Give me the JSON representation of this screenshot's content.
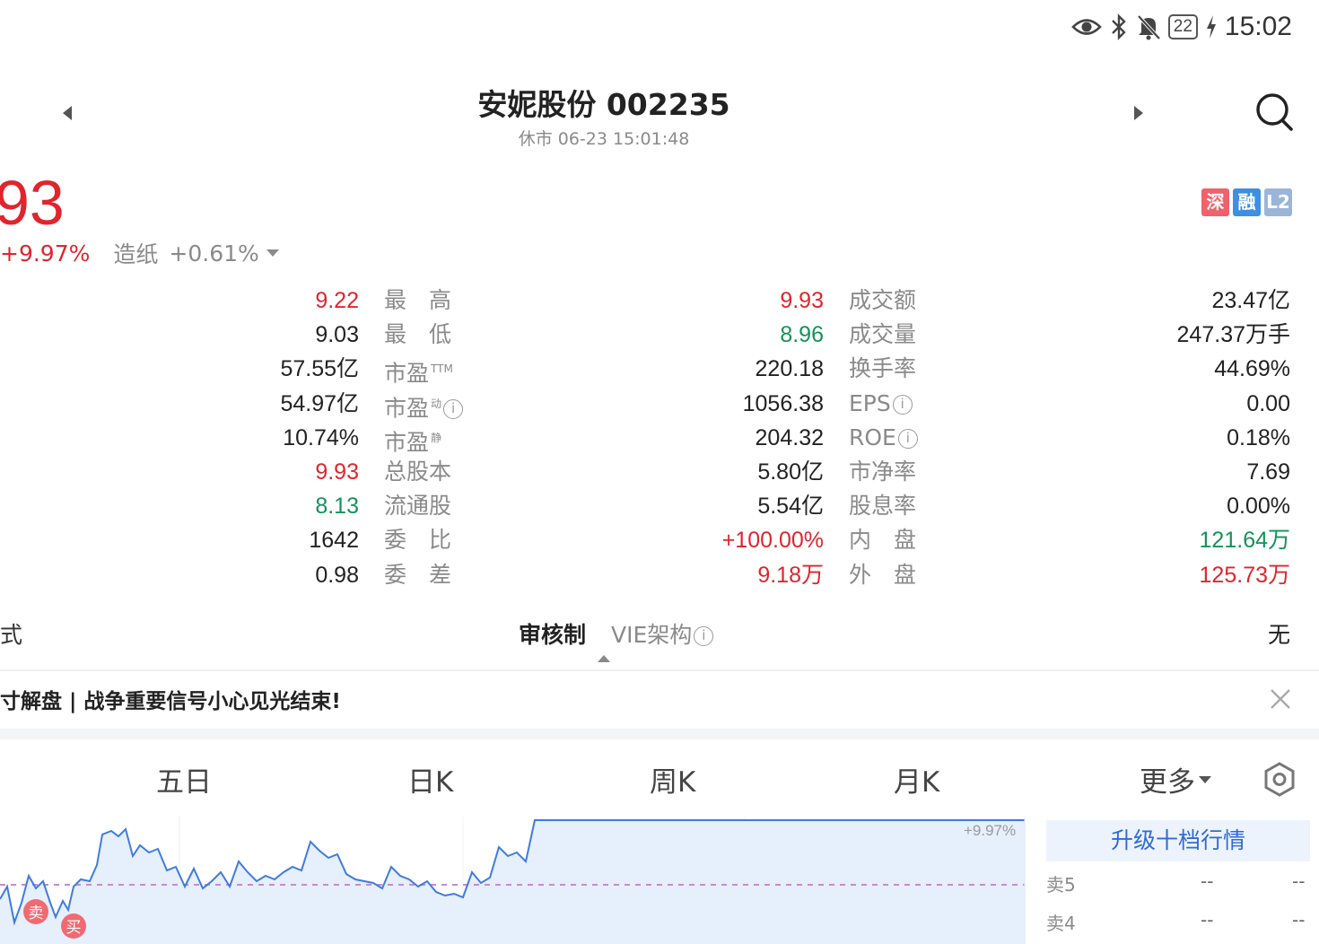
{
  "status_bar": {
    "battery": "22",
    "time": "15:02"
  },
  "header": {
    "title": "安妮股份 002235",
    "subtitle": "休市  06-23 15:01:48"
  },
  "price": {
    "last": "93",
    "change_pct": "+9.97%",
    "sector_name": "造纸",
    "sector_pct": "+0.61%"
  },
  "badges": [
    {
      "label": "深",
      "color": "#f0616b"
    },
    {
      "label": "融",
      "color": "#3d8fe3"
    },
    {
      "label": "L2",
      "color": "#9bb5d9"
    }
  ],
  "stats": [
    {
      "v1": "9.22",
      "c1": "red",
      "l1": "最　高",
      "v2": "9.93",
      "c2": "red",
      "l2": "成交额",
      "v3": "23.47亿",
      "c3": ""
    },
    {
      "v1": "9.03",
      "c1": "",
      "l1": "最　低",
      "v2": "8.96",
      "c2": "green",
      "l2": "成交量",
      "v3": "247.37万手",
      "c3": ""
    },
    {
      "v1": "57.55亿",
      "c1": "",
      "l1": "市盈",
      "s1": "TTM",
      "v2": "220.18",
      "c2": "",
      "l2": "换手率",
      "v3": "44.69%",
      "c3": ""
    },
    {
      "v1": "54.97亿",
      "c1": "",
      "l1": "市盈",
      "s1": "动",
      "v2": "1056.38",
      "c2": "",
      "l2": "EPS",
      "v3": "0.00",
      "c3": ""
    },
    {
      "v1": "10.74%",
      "c1": "",
      "l1": "市盈",
      "s1": "静",
      "v2": "204.32",
      "c2": "",
      "l2": "ROE",
      "v3": "0.18%",
      "c3": ""
    },
    {
      "v1": "9.93",
      "c1": "red",
      "l1": "总股本",
      "v2": "5.80亿",
      "c2": "",
      "l2": "市净率",
      "v3": "7.69",
      "c3": ""
    },
    {
      "v1": "8.13",
      "c1": "green",
      "l1": "流通股",
      "v2": "5.54亿",
      "c2": "",
      "l2": "股息率",
      "v3": "0.00%",
      "c3": ""
    },
    {
      "v1": "1642",
      "c1": "",
      "l1": "委　比",
      "v2": "+100.00%",
      "c2": "red",
      "l2": "内　盘",
      "v3": "121.64万",
      "c3": "green"
    },
    {
      "v1": "0.98",
      "c1": "",
      "l1": "委　差",
      "v2": "9.18万",
      "c2": "red",
      "l2": "外　盘",
      "v3": "125.73万",
      "c3": "red"
    }
  ],
  "audit": {
    "left": "式",
    "active": "审核制",
    "inactive": "VIE架构",
    "value": "无"
  },
  "news": {
    "text": "寸解盘 | 战争重要信号小心见光结束!"
  },
  "tabs": [
    "五日",
    "日K",
    "周K",
    "月K"
  ],
  "more_label": "更多",
  "chart": {
    "top_label": "+9.97%",
    "markers": [
      "卖",
      "买"
    ]
  },
  "orderbook": {
    "upgrade_label": "升级十档行情",
    "rows": [
      {
        "label": "卖5",
        "price": "--",
        "vol": "--"
      },
      {
        "label": "卖4",
        "price": "--",
        "vol": "--"
      }
    ]
  }
}
